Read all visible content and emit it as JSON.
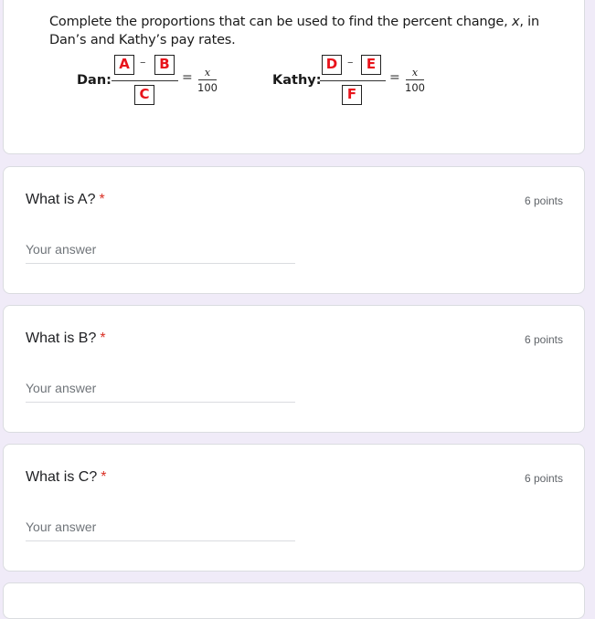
{
  "intro": {
    "text_before": "Complete the proportions that can be used to find the percent change, ",
    "variable": "x",
    "text_after": ", in Dan’s and Kathy’s pay rates.",
    "dan": {
      "label": "Dan:",
      "top_left": "A",
      "top_right": "B",
      "bottom": "C",
      "minus": "–",
      "equals": "=",
      "x": "x",
      "den": "100"
    },
    "kathy": {
      "label": "Kathy:",
      "top_left": "D",
      "top_right": "E",
      "bottom": "F",
      "minus": "–",
      "equals": "=",
      "x": "x",
      "den": "100"
    }
  },
  "questions": [
    {
      "title": "What is A?",
      "required_mark": "*",
      "points": "6 points",
      "placeholder": "Your answer"
    },
    {
      "title": "What is B?",
      "required_mark": "*",
      "points": "6 points",
      "placeholder": "Your answer"
    },
    {
      "title": "What is C?",
      "required_mark": "*",
      "points": "6 points",
      "placeholder": "Your answer"
    }
  ],
  "colors": {
    "box_letter": "#e8131b",
    "required": "#d93025",
    "page_background": "#f0ebf8"
  }
}
